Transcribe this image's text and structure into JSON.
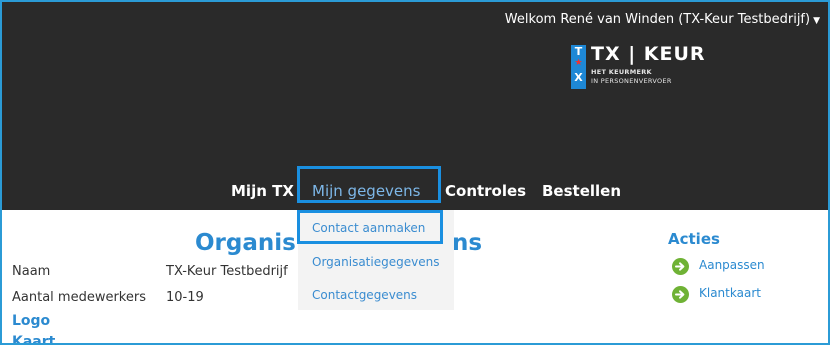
{
  "header": {
    "welcome_text": "Welkom René van Winden (TX-Keur Testbedrijf)",
    "logo": {
      "mark_letters": [
        "T",
        "★",
        "X"
      ],
      "brand": "TX | KEUR",
      "tagline_1": "HET KEURMERK",
      "tagline_2": "IN PERSONENVERVOER"
    }
  },
  "nav": {
    "items": [
      {
        "label": "Mijn TX"
      },
      {
        "label": "Mijn gegevens"
      },
      {
        "label": "Controles"
      },
      {
        "label": "Bestellen"
      }
    ],
    "active_item": "Mijn gegevens"
  },
  "dropdown": {
    "items": [
      {
        "label": "Contact aanmaken"
      },
      {
        "label": "Organisatiegegevens"
      },
      {
        "label": "Contactgegevens"
      }
    ]
  },
  "main": {
    "title_visible_start": "Organis",
    "title_visible_end": "ns",
    "fields": [
      {
        "label": "Naam",
        "value": "TX-Keur Testbedrijf"
      },
      {
        "label": "Aantal medewerkers",
        "value": "10-19"
      }
    ],
    "sections": [
      "Logo",
      "Kaart"
    ]
  },
  "actions": {
    "title": "Acties",
    "items": [
      {
        "label": "Aanpassen",
        "icon": "arrow-right-circle-icon"
      },
      {
        "label": "Klantkaart",
        "icon": "arrow-right-circle-icon"
      }
    ]
  },
  "colors": {
    "header_bg": "#2a2a2a",
    "accent_blue": "#2b8ad0",
    "highlight_border": "#1a8fe0",
    "action_green": "#6fb235"
  }
}
